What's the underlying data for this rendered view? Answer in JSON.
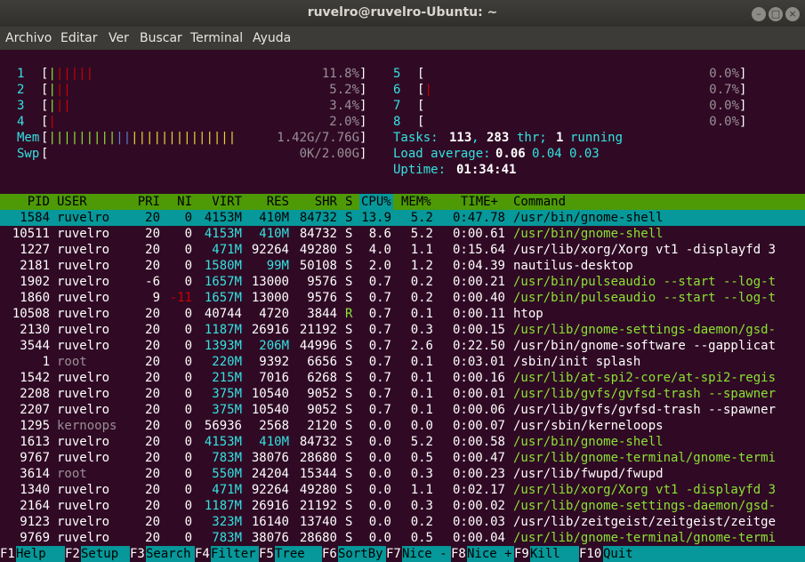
{
  "window": {
    "title": "ruvelro@ruvelro-Ubuntu: ~",
    "minimize_glyph": "–",
    "maximize_glyph": "□",
    "close_glyph": "×"
  },
  "menu": [
    "Archivo",
    "Editar",
    "Ver",
    "Buscar",
    "Terminal",
    "Ayuda"
  ],
  "cpus": [
    {
      "n": "1",
      "pct": "11.8%"
    },
    {
      "n": "2",
      "pct": "5.2%"
    },
    {
      "n": "3",
      "pct": "3.4%"
    },
    {
      "n": "4",
      "pct": "2.0%"
    },
    {
      "n": "5",
      "pct": "0.0%"
    },
    {
      "n": "6",
      "pct": "0.7%"
    },
    {
      "n": "7",
      "pct": "0.0%"
    },
    {
      "n": "8",
      "pct": "0.0%"
    }
  ],
  "mem": {
    "label": "Mem",
    "value": "1.42G/7.76G"
  },
  "swp": {
    "label": "Swp",
    "value": "0K/2.00G"
  },
  "tasks": {
    "label": "Tasks:",
    "count": "113",
    "sep1": ",",
    "threads": "283",
    "thr": "thr;",
    "running": "1",
    "running_label": "running"
  },
  "load": {
    "label": "Load average:",
    "v1": "0.06",
    "v2": "0.04",
    "v3": "0.03"
  },
  "uptime": {
    "label": "Uptime:",
    "value": "01:34:41"
  },
  "columns": {
    "pid": "PID",
    "user": "USER",
    "pri": "PRI",
    "ni": "NI",
    "virt": "VIRT",
    "res": "RES",
    "shr": "SHR",
    "s": "S",
    "cpu": "CPU%",
    "mem": "MEM%",
    "time": "TIME+",
    "cmd": "Command"
  },
  "processes": [
    {
      "pid": "1584",
      "user": "ruvelro",
      "pri": "20",
      "ni": "0",
      "virt": "4153M",
      "res": "410M",
      "shr": "84732",
      "s": "S",
      "cpu": "13.9",
      "mem": "5.2",
      "time": "0:47.78",
      "cmd": "/usr/bin/gnome-shell"
    },
    {
      "pid": "10511",
      "user": "ruvelro",
      "pri": "20",
      "ni": "0",
      "virt": "4153M",
      "res": "410M",
      "shr": "84732",
      "s": "S",
      "cpu": "8.6",
      "mem": "5.2",
      "time": "0:00.61",
      "cmd": "/usr/bin/gnome-shell"
    },
    {
      "pid": "1227",
      "user": "ruvelro",
      "pri": "20",
      "ni": "0",
      "virt": "471M",
      "res": "92264",
      "shr": "49280",
      "s": "S",
      "cpu": "4.0",
      "mem": "1.1",
      "time": "0:15.64",
      "cmd": "/usr/lib/xorg/Xorg vt1 -displayfd 3"
    },
    {
      "pid": "2181",
      "user": "ruvelro",
      "pri": "20",
      "ni": "0",
      "virt": "1580M",
      "res": "99M",
      "shr": "50108",
      "s": "S",
      "cpu": "2.0",
      "mem": "1.2",
      "time": "0:04.39",
      "cmd": "nautilus-desktop"
    },
    {
      "pid": "1902",
      "user": "ruvelro",
      "pri": "-6",
      "ni": "0",
      "virt": "1657M",
      "res": "13000",
      "shr": "9576",
      "s": "S",
      "cpu": "0.7",
      "mem": "0.2",
      "time": "0:00.21",
      "cmd": "/usr/bin/pulseaudio --start --log-t"
    },
    {
      "pid": "1860",
      "user": "ruvelro",
      "pri": "9",
      "ni": "-11",
      "virt": "1657M",
      "res": "13000",
      "shr": "9576",
      "s": "S",
      "cpu": "0.7",
      "mem": "0.2",
      "time": "0:00.40",
      "cmd": "/usr/bin/pulseaudio --start --log-t"
    },
    {
      "pid": "10508",
      "user": "ruvelro",
      "pri": "20",
      "ni": "0",
      "virt": "40744",
      "res": "4720",
      "shr": "3844",
      "s": "R",
      "cpu": "0.7",
      "mem": "0.1",
      "time": "0:00.11",
      "cmd": "htop"
    },
    {
      "pid": "2130",
      "user": "ruvelro",
      "pri": "20",
      "ni": "0",
      "virt": "1187M",
      "res": "26916",
      "shr": "21192",
      "s": "S",
      "cpu": "0.7",
      "mem": "0.3",
      "time": "0:00.15",
      "cmd": "/usr/lib/gnome-settings-daemon/gsd-"
    },
    {
      "pid": "3544",
      "user": "ruvelro",
      "pri": "20",
      "ni": "0",
      "virt": "1393M",
      "res": "206M",
      "shr": "44996",
      "s": "S",
      "cpu": "0.7",
      "mem": "2.6",
      "time": "0:22.50",
      "cmd": "/usr/bin/gnome-software --gapplicat"
    },
    {
      "pid": "1",
      "user": "root",
      "pri": "20",
      "ni": "0",
      "virt": "220M",
      "res": "9392",
      "shr": "6656",
      "s": "S",
      "cpu": "0.7",
      "mem": "0.1",
      "time": "0:03.01",
      "cmd": "/sbin/init splash"
    },
    {
      "pid": "1542",
      "user": "ruvelro",
      "pri": "20",
      "ni": "0",
      "virt": "215M",
      "res": "7016",
      "shr": "6268",
      "s": "S",
      "cpu": "0.7",
      "mem": "0.1",
      "time": "0:00.16",
      "cmd": "/usr/lib/at-spi2-core/at-spi2-regis"
    },
    {
      "pid": "2208",
      "user": "ruvelro",
      "pri": "20",
      "ni": "0",
      "virt": "375M",
      "res": "10540",
      "shr": "9052",
      "s": "S",
      "cpu": "0.7",
      "mem": "0.1",
      "time": "0:00.01",
      "cmd": "/usr/lib/gvfs/gvfsd-trash --spawner"
    },
    {
      "pid": "2207",
      "user": "ruvelro",
      "pri": "20",
      "ni": "0",
      "virt": "375M",
      "res": "10540",
      "shr": "9052",
      "s": "S",
      "cpu": "0.7",
      "mem": "0.1",
      "time": "0:00.06",
      "cmd": "/usr/lib/gvfs/gvfsd-trash --spawner"
    },
    {
      "pid": "1295",
      "user": "kernoops",
      "pri": "20",
      "ni": "0",
      "virt": "56936",
      "res": "2568",
      "shr": "2120",
      "s": "S",
      "cpu": "0.0",
      "mem": "0.0",
      "time": "0:00.07",
      "cmd": "/usr/sbin/kerneloops"
    },
    {
      "pid": "1613",
      "user": "ruvelro",
      "pri": "20",
      "ni": "0",
      "virt": "4153M",
      "res": "410M",
      "shr": "84732",
      "s": "S",
      "cpu": "0.0",
      "mem": "5.2",
      "time": "0:00.58",
      "cmd": "/usr/bin/gnome-shell"
    },
    {
      "pid": "9767",
      "user": "ruvelro",
      "pri": "20",
      "ni": "0",
      "virt": "783M",
      "res": "38076",
      "shr": "28680",
      "s": "S",
      "cpu": "0.0",
      "mem": "0.5",
      "time": "0:00.47",
      "cmd": "/usr/lib/gnome-terminal/gnome-termi"
    },
    {
      "pid": "3614",
      "user": "root",
      "pri": "20",
      "ni": "0",
      "virt": "550M",
      "res": "24204",
      "shr": "15344",
      "s": "S",
      "cpu": "0.0",
      "mem": "0.3",
      "time": "0:00.23",
      "cmd": "/usr/lib/fwupd/fwupd"
    },
    {
      "pid": "1340",
      "user": "ruvelro",
      "pri": "20",
      "ni": "0",
      "virt": "471M",
      "res": "92264",
      "shr": "49280",
      "s": "S",
      "cpu": "0.0",
      "mem": "1.1",
      "time": "0:02.17",
      "cmd": "/usr/lib/xorg/Xorg vt1 -displayfd 3"
    },
    {
      "pid": "2164",
      "user": "ruvelro",
      "pri": "20",
      "ni": "0",
      "virt": "1187M",
      "res": "26916",
      "shr": "21192",
      "s": "S",
      "cpu": "0.0",
      "mem": "0.3",
      "time": "0:00.02",
      "cmd": "/usr/lib/gnome-settings-daemon/gsd-"
    },
    {
      "pid": "9123",
      "user": "ruvelro",
      "pri": "20",
      "ni": "0",
      "virt": "323M",
      "res": "16140",
      "shr": "13740",
      "s": "S",
      "cpu": "0.0",
      "mem": "0.2",
      "time": "0:00.03",
      "cmd": "/usr/lib/zeitgeist/zeitgeist/zeitge"
    },
    {
      "pid": "9769",
      "user": "ruvelro",
      "pri": "20",
      "ni": "0",
      "virt": "783M",
      "res": "38076",
      "shr": "28680",
      "s": "S",
      "cpu": "0.0",
      "mem": "0.5",
      "time": "0:00.04",
      "cmd": "/usr/lib/gnome-terminal/gnome-termi"
    }
  ],
  "fkeys": [
    {
      "key": "F1",
      "label": "Help"
    },
    {
      "key": "F2",
      "label": "Setup"
    },
    {
      "key": "F3",
      "label": "Search"
    },
    {
      "key": "F4",
      "label": "Filter"
    },
    {
      "key": "F5",
      "label": "Tree"
    },
    {
      "key": "F6",
      "label": "SortBy"
    },
    {
      "key": "F7",
      "label": "Nice -"
    },
    {
      "key": "F8",
      "label": "Nice +"
    },
    {
      "key": "F9",
      "label": "Kill"
    },
    {
      "key": "F10",
      "label": "Quit"
    }
  ],
  "colors": {
    "header_bg": "#4e9a06",
    "selected_bg": "#06989a",
    "terminal_bg": "#300a24"
  }
}
